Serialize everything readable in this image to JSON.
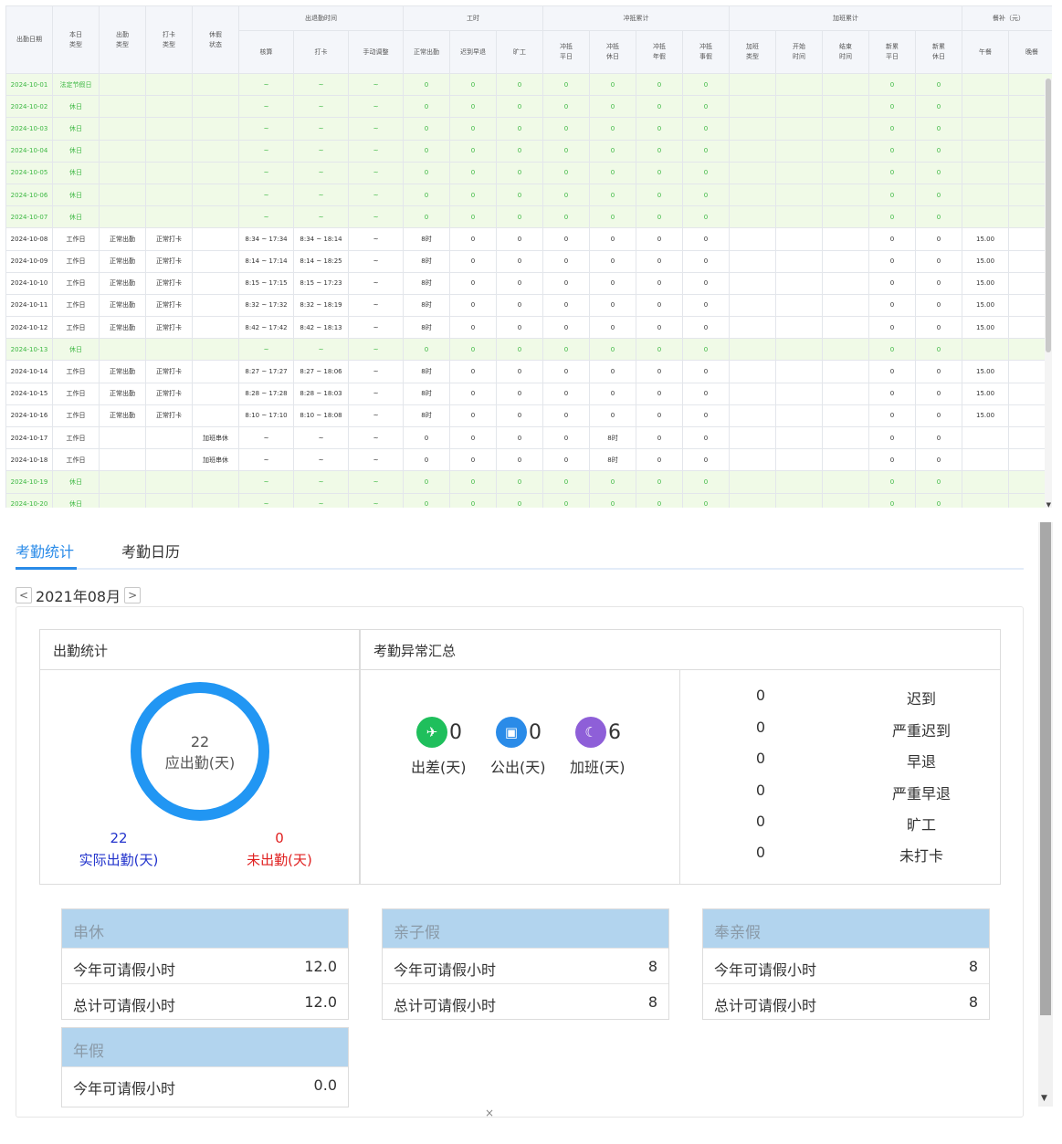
{
  "table": {
    "header_top": {
      "date": "出勤日期",
      "day_type": "本日\n类型",
      "attend_type": "出勤\n类型",
      "punch_type": "打卡\n类型",
      "leave_status": "休假\n状态",
      "attend_time": "出退勤时间",
      "work_hours": "工时",
      "offset": "冲抵累计",
      "overtime": "加班累计",
      "meal": "餐补（元）"
    },
    "header_sub": [
      "核算",
      "打卡",
      "手动调整",
      "正常出勤",
      "迟到早退",
      "旷工",
      "冲抵\n平日",
      "冲抵\n休日",
      "冲抵\n年假",
      "冲抵\n事假",
      "加班\n类型",
      "开始\n时间",
      "结束\n时间",
      "新累\n平日",
      "新累\n休日",
      "午餐",
      "晚餐"
    ],
    "rows": [
      {
        "kind": "rest",
        "cells": [
          "2024-10-01",
          "法定节假日",
          "",
          "",
          "",
          "~",
          "~",
          "~",
          "0",
          "0",
          "0",
          "0",
          "0",
          "0",
          "0",
          "",
          "",
          "",
          "0",
          "0",
          "",
          ""
        ]
      },
      {
        "kind": "rest",
        "cells": [
          "2024-10-02",
          "休日",
          "",
          "",
          "",
          "~",
          "~",
          "~",
          "0",
          "0",
          "0",
          "0",
          "0",
          "0",
          "0",
          "",
          "",
          "",
          "0",
          "0",
          "",
          ""
        ]
      },
      {
        "kind": "rest",
        "cells": [
          "2024-10-03",
          "休日",
          "",
          "",
          "",
          "~",
          "~",
          "~",
          "0",
          "0",
          "0",
          "0",
          "0",
          "0",
          "0",
          "",
          "",
          "",
          "0",
          "0",
          "",
          ""
        ]
      },
      {
        "kind": "rest",
        "cells": [
          "2024-10-04",
          "休日",
          "",
          "",
          "",
          "~",
          "~",
          "~",
          "0",
          "0",
          "0",
          "0",
          "0",
          "0",
          "0",
          "",
          "",
          "",
          "0",
          "0",
          "",
          ""
        ]
      },
      {
        "kind": "rest",
        "cells": [
          "2024-10-05",
          "休日",
          "",
          "",
          "",
          "~",
          "~",
          "~",
          "0",
          "0",
          "0",
          "0",
          "0",
          "0",
          "0",
          "",
          "",
          "",
          "0",
          "0",
          "",
          ""
        ]
      },
      {
        "kind": "rest",
        "cells": [
          "2024-10-06",
          "休日",
          "",
          "",
          "",
          "~",
          "~",
          "~",
          "0",
          "0",
          "0",
          "0",
          "0",
          "0",
          "0",
          "",
          "",
          "",
          "0",
          "0",
          "",
          ""
        ]
      },
      {
        "kind": "rest",
        "cells": [
          "2024-10-07",
          "休日",
          "",
          "",
          "",
          "~",
          "~",
          "~",
          "0",
          "0",
          "0",
          "0",
          "0",
          "0",
          "0",
          "",
          "",
          "",
          "0",
          "0",
          "",
          ""
        ]
      },
      {
        "kind": "work",
        "cells": [
          "2024-10-08",
          "工作日",
          "正常出勤",
          "正常打卡",
          "",
          "8:34 ~ 17:34",
          "8:34 ~ 18:14",
          "~",
          "8时",
          "0",
          "0",
          "0",
          "0",
          "0",
          "0",
          "",
          "",
          "",
          "0",
          "0",
          "15.00",
          ""
        ]
      },
      {
        "kind": "work",
        "cells": [
          "2024-10-09",
          "工作日",
          "正常出勤",
          "正常打卡",
          "",
          "8:14 ~ 17:14",
          "8:14 ~ 18:25",
          "~",
          "8时",
          "0",
          "0",
          "0",
          "0",
          "0",
          "0",
          "",
          "",
          "",
          "0",
          "0",
          "15.00",
          ""
        ]
      },
      {
        "kind": "work",
        "cells": [
          "2024-10-10",
          "工作日",
          "正常出勤",
          "正常打卡",
          "",
          "8:15 ~ 17:15",
          "8:15 ~ 17:23",
          "~",
          "8时",
          "0",
          "0",
          "0",
          "0",
          "0",
          "0",
          "",
          "",
          "",
          "0",
          "0",
          "15.00",
          ""
        ]
      },
      {
        "kind": "work",
        "cells": [
          "2024-10-11",
          "工作日",
          "正常出勤",
          "正常打卡",
          "",
          "8:32 ~ 17:32",
          "8:32 ~ 18:19",
          "~",
          "8时",
          "0",
          "0",
          "0",
          "0",
          "0",
          "0",
          "",
          "",
          "",
          "0",
          "0",
          "15.00",
          ""
        ]
      },
      {
        "kind": "work",
        "cells": [
          "2024-10-12",
          "工作日",
          "正常出勤",
          "正常打卡",
          "",
          "8:42 ~ 17:42",
          "8:42 ~ 18:13",
          "~",
          "8时",
          "0",
          "0",
          "0",
          "0",
          "0",
          "0",
          "",
          "",
          "",
          "0",
          "0",
          "15.00",
          ""
        ]
      },
      {
        "kind": "rest",
        "cells": [
          "2024-10-13",
          "休日",
          "",
          "",
          "",
          "~",
          "~",
          "~",
          "0",
          "0",
          "0",
          "0",
          "0",
          "0",
          "0",
          "",
          "",
          "",
          "0",
          "0",
          "",
          ""
        ]
      },
      {
        "kind": "work",
        "cells": [
          "2024-10-14",
          "工作日",
          "正常出勤",
          "正常打卡",
          "",
          "8:27 ~ 17:27",
          "8:27 ~ 18:06",
          "~",
          "8时",
          "0",
          "0",
          "0",
          "0",
          "0",
          "0",
          "",
          "",
          "",
          "0",
          "0",
          "15.00",
          ""
        ]
      },
      {
        "kind": "work",
        "cells": [
          "2024-10-15",
          "工作日",
          "正常出勤",
          "正常打卡",
          "",
          "8:28 ~ 17:28",
          "8:28 ~ 18:03",
          "~",
          "8时",
          "0",
          "0",
          "0",
          "0",
          "0",
          "0",
          "",
          "",
          "",
          "0",
          "0",
          "15.00",
          ""
        ]
      },
      {
        "kind": "work",
        "cells": [
          "2024-10-16",
          "工作日",
          "正常出勤",
          "正常打卡",
          "",
          "8:10 ~ 17:10",
          "8:10 ~ 18:08",
          "~",
          "8时",
          "0",
          "0",
          "0",
          "0",
          "0",
          "0",
          "",
          "",
          "",
          "0",
          "0",
          "15.00",
          ""
        ]
      },
      {
        "kind": "work",
        "cells": [
          "2024-10-17",
          "工作日",
          "",
          "",
          "加班串休",
          "~",
          "~",
          "~",
          "0",
          "0",
          "0",
          "0",
          "8时",
          "0",
          "0",
          "",
          "",
          "",
          "0",
          "0",
          "",
          ""
        ]
      },
      {
        "kind": "work",
        "cells": [
          "2024-10-18",
          "工作日",
          "",
          "",
          "加班串休",
          "~",
          "~",
          "~",
          "0",
          "0",
          "0",
          "0",
          "8时",
          "0",
          "0",
          "",
          "",
          "",
          "0",
          "0",
          "",
          ""
        ]
      },
      {
        "kind": "rest",
        "cells": [
          "2024-10-19",
          "休日",
          "",
          "",
          "",
          "~",
          "~",
          "~",
          "0",
          "0",
          "0",
          "0",
          "0",
          "0",
          "0",
          "",
          "",
          "",
          "0",
          "0",
          "",
          ""
        ]
      },
      {
        "kind": "rest",
        "cells": [
          "2024-10-20",
          "休日",
          "",
          "",
          "",
          "~",
          "~",
          "~",
          "0",
          "0",
          "0",
          "0",
          "0",
          "0",
          "0",
          "",
          "",
          "",
          "0",
          "0",
          "",
          ""
        ]
      }
    ]
  },
  "tabs": {
    "stats": "考勤统计",
    "calendar": "考勤日历"
  },
  "month": {
    "label": "2021年08月",
    "prev": "<",
    "next": ">"
  },
  "attendance": {
    "title": "出勤统计",
    "ring_value": "22",
    "ring_label": "应出勤(天)",
    "actual_value": "22",
    "actual_label": "实际出勤(天)",
    "absent_value": "0",
    "absent_label": "未出勤(天)",
    "ring_color": "#2196f3",
    "actual_color": "#2233cc",
    "absent_color": "#e02020"
  },
  "abnormal": {
    "title": "考勤异常汇总",
    "icons": [
      {
        "value": "0",
        "label": "出差(天)",
        "icon": "plane-icon",
        "color": "#1fbf5c"
      },
      {
        "value": "0",
        "label": "公出(天)",
        "icon": "briefcase-icon",
        "color": "#2a8be8"
      },
      {
        "value": "6",
        "label": "加班(天)",
        "icon": "moon-icon",
        "color": "#8e5fd8"
      }
    ],
    "rows": [
      {
        "count": "0",
        "label": "迟到"
      },
      {
        "count": "0",
        "label": "严重迟到"
      },
      {
        "count": "0",
        "label": "早退"
      },
      {
        "count": "0",
        "label": "严重早退"
      },
      {
        "count": "0",
        "label": "旷工"
      },
      {
        "count": "0",
        "label": "未打卡"
      }
    ]
  },
  "leave": [
    {
      "title": "串休",
      "rows": [
        {
          "label": "今年可请假小时",
          "value": "12.0"
        },
        {
          "label": "总计可请假小时",
          "value": "12.0"
        }
      ]
    },
    {
      "title": "亲子假",
      "rows": [
        {
          "label": "今年可请假小时",
          "value": "8"
        },
        {
          "label": "总计可请假小时",
          "value": "8"
        }
      ]
    },
    {
      "title": "奉亲假",
      "rows": [
        {
          "label": "今年可请假小时",
          "value": "8"
        },
        {
          "label": "总计可请假小时",
          "value": "8"
        }
      ]
    },
    {
      "title": "年假",
      "rows": [
        {
          "label": "今年可请假小时",
          "value": "0.0"
        }
      ]
    }
  ],
  "close_label": "×"
}
